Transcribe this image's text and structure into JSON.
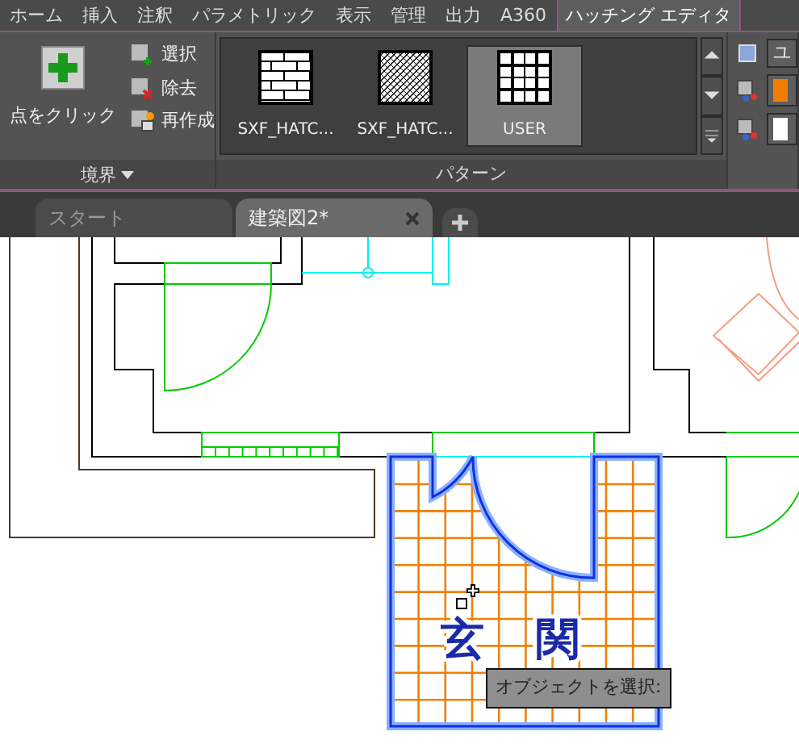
{
  "ribbon_tabs": [
    {
      "label": "ホーム",
      "selected": false
    },
    {
      "label": "挿入",
      "selected": false
    },
    {
      "label": "注釈",
      "selected": false
    },
    {
      "label": "パラメトリック",
      "selected": false
    },
    {
      "label": "表示",
      "selected": false
    },
    {
      "label": "管理",
      "selected": false
    },
    {
      "label": "出力",
      "selected": false
    },
    {
      "label": "A360",
      "selected": false
    },
    {
      "label": "ハッチング エディタ",
      "selected": true
    }
  ],
  "boundary_panel": {
    "title": "境界",
    "pick_button": "点をクリック",
    "buttons": [
      {
        "label": "選択",
        "kind": "select"
      },
      {
        "label": "除去",
        "kind": "remove"
      },
      {
        "label": "再作成",
        "kind": "recreate"
      }
    ]
  },
  "pattern_panel": {
    "title": "パターン",
    "patterns": [
      {
        "label": "SXF_HATC...",
        "kind": "brick",
        "selected": false
      },
      {
        "label": "SXF_HATC...",
        "kind": "herringbone",
        "selected": false
      },
      {
        "label": "USER",
        "kind": "grid",
        "selected": true
      }
    ]
  },
  "properties_panel": {
    "pattern_type": "ユ",
    "swatches": [
      {
        "color": "#f07d00"
      },
      {
        "color": "#ffffff"
      }
    ]
  },
  "file_tabs": [
    {
      "label": "スタート",
      "selected": false,
      "closable": false
    },
    {
      "label": "建築図2*",
      "selected": true,
      "closable": true
    }
  ],
  "drawing": {
    "room_label": "玄関",
    "tooltip": "オブジェクトを選択:"
  }
}
